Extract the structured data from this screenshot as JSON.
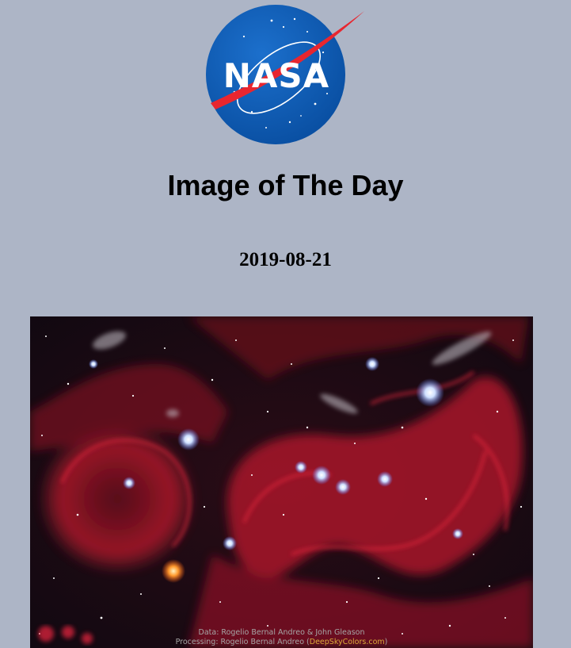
{
  "header": {
    "logo_text": "NASA",
    "title": "Image of The Day",
    "date": "2019-08-21"
  },
  "image": {
    "credit_line1": "Data: Rogelio Bernal Andreo & John Gleason",
    "credit_line2_prefix": "Processing: Rogelio Bernal Andreo (",
    "credit_line2_site": "DeepSkyColors.com",
    "credit_line2_suffix": ")"
  },
  "colors": {
    "background": "#adb5c6",
    "nasa_blue": "#0b3d91",
    "nasa_red": "#fc3d21",
    "nebula_red": "#c01b2c",
    "credit_site": "#d9a93a"
  },
  "icons": {
    "logo": "nasa-meatball-logo"
  }
}
